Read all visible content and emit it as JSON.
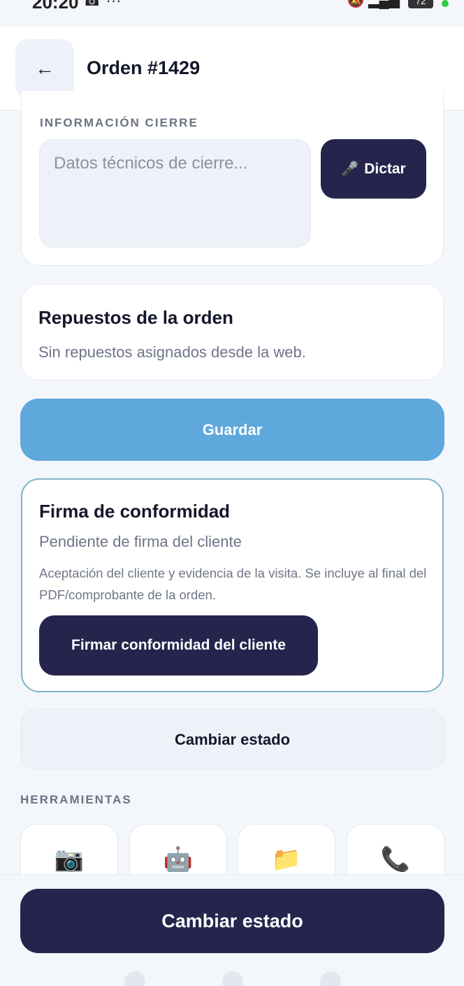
{
  "status_bar": {
    "time": "20:20",
    "icons": "☎ ···",
    "right_icons": "🔕 ▂▄▆",
    "battery": "72"
  },
  "header": {
    "back_icon": "←",
    "title": "Orden #1429"
  },
  "closing_info": {
    "section_label": "INFORMACIÓN CIERRE",
    "placeholder": "Datos técnicos de cierre...",
    "dictate_icon": "🎤",
    "dictate_label": "Dictar"
  },
  "parts": {
    "title": "Repuestos de la orden",
    "subtitle": "Sin repuestos asignados desde la web."
  },
  "save_button": "Guardar",
  "signature": {
    "title": "Firma de conformidad",
    "status": "Pendiente de firma del cliente",
    "description": "Aceptación del cliente y evidencia de la visita. Se incluye al final del PDF/comprobante de la orden.",
    "button": "Firmar conformidad del cliente"
  },
  "change_state_secondary": "Cambiar estado",
  "tools": {
    "label": "HERRAMIENTAS",
    "items": [
      {
        "icon": "📷",
        "name": "camera-icon"
      },
      {
        "icon": "🤖",
        "name": "robot-icon"
      },
      {
        "icon": "📁",
        "name": "folder-icon"
      },
      {
        "icon": "📞",
        "name": "phone-icon"
      }
    ]
  },
  "primary_action": "Cambiar estado",
  "colors": {
    "primary_dark": "#25244d",
    "save_blue": "#5fa8dc",
    "sign_border": "#7fb4c8"
  }
}
